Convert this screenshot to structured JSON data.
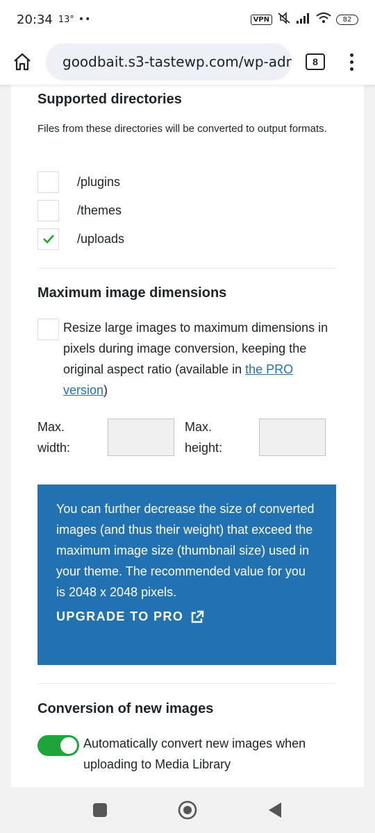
{
  "status_bar": {
    "time": "20:34",
    "temperature": "13°",
    "dots": "••",
    "vpn": "VPN",
    "battery": "82"
  },
  "browser": {
    "url": "goodbait.s3-tastewp.com/wp-admin",
    "tab_count": "8"
  },
  "supported_directories": {
    "title": "Supported directories",
    "description": "Files from these directories will be converted to output formats.",
    "items": [
      {
        "label": "/plugins",
        "checked": false
      },
      {
        "label": "/themes",
        "checked": false
      },
      {
        "label": "/uploads",
        "checked": true
      }
    ]
  },
  "max_dimensions": {
    "title": "Maximum image dimensions",
    "resize_text": "Resize large images to maximum dimensions in pixels during image conversion, keeping the original aspect ratio (available in ",
    "pro_link": "the PRO version",
    "resize_text_end": ")",
    "max_width_label_1": "Max.",
    "max_width_label_2": "width:",
    "max_height_label_1": "Max.",
    "max_height_label_2": "height:",
    "max_width_value": "",
    "max_height_value": ""
  },
  "promo": {
    "text": "You can further decrease the size of converted images (and thus their weight) that exceed the maximum image size (thumbnail size) used in your theme. The recommended value for you is 2048 x 2048 pixels.",
    "link_label": "UPGRADE TO PRO"
  },
  "new_images": {
    "title": "Conversion of new images",
    "toggle_label": "Automatically convert new images when uploading to Media Library",
    "toggle_on": true
  },
  "colors": {
    "accent": "#2271b1",
    "toggle_on": "#1fa33b",
    "check": "#1fa33b"
  }
}
